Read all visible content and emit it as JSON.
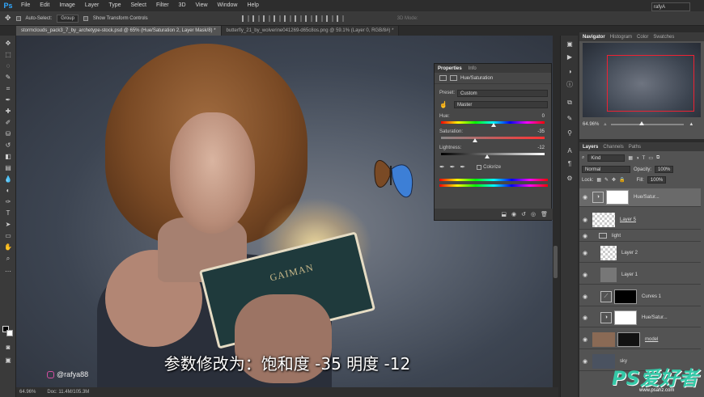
{
  "app": {
    "logo": "Ps"
  },
  "menu": [
    "File",
    "Edit",
    "Image",
    "Layer",
    "Type",
    "Select",
    "Filter",
    "3D",
    "View",
    "Window",
    "Help"
  ],
  "options": {
    "auto_select": "Auto-Select:",
    "auto_select_value": "Group",
    "transform_controls": "Show Transform Controls",
    "mode_3d": "3D Mode:",
    "workspace": "rafyA"
  },
  "doc_tabs": [
    "stormclouds_pack3_7_by_archetype-stock.psd @ 65% (Hue/Saturation 2, Layer Mask/8) *",
    "butterfly_21_by_wolverine041269-d65c8os.png @ 59.1% (Layer 0, RGB/8#) *"
  ],
  "properties": {
    "tabs": [
      "Properties",
      "Info"
    ],
    "adjustment": "Hue/Saturation",
    "preset_label": "Preset:",
    "preset_value": "Custom",
    "channel_value": "Master",
    "hue_label": "Hue:",
    "hue_value": "0",
    "saturation_label": "Saturation:",
    "saturation_value": "-35",
    "lightness_label": "Lightness:",
    "lightness_value": "-12",
    "colorize_label": "Colorize"
  },
  "navigator": {
    "tabs": [
      "Navigator",
      "Histogram",
      "Color",
      "Swatches"
    ],
    "zoom": "64.96%"
  },
  "layers_panel": {
    "tabs": [
      "Layers",
      "Channels",
      "Paths"
    ],
    "filter": "Kind",
    "blend_mode": "Normal",
    "opacity_label": "Opacity:",
    "opacity_value": "100%",
    "lock_label": "Lock:",
    "fill_label": "Fill:",
    "fill_value": "100%",
    "layers": [
      {
        "name": "Hue/Satur...",
        "kind": "adjustment",
        "selected": true
      },
      {
        "name": "Layer 5",
        "kind": "pixel",
        "underline": true
      },
      {
        "name": "light",
        "kind": "group"
      },
      {
        "name": "Layer 2",
        "kind": "pixel"
      },
      {
        "name": "Layer 1",
        "kind": "pixel"
      },
      {
        "name": "Curves 1",
        "kind": "adjustment"
      },
      {
        "name": "Hue/Satur...",
        "kind": "adjustment"
      },
      {
        "name": "model",
        "kind": "image",
        "underline": true
      },
      {
        "name": "sky",
        "kind": "image"
      }
    ]
  },
  "canvas": {
    "subtitle": "参数修改为：饱和度 -35 明度 -12",
    "handle": "@rafya88",
    "book_title": "GAIMAN"
  },
  "status": {
    "zoom": "64.96%",
    "doc": "Doc: 11.4M/105.3M"
  },
  "site_watermark": {
    "brand": "PS爱好者",
    "url": "www.psahz.com"
  }
}
